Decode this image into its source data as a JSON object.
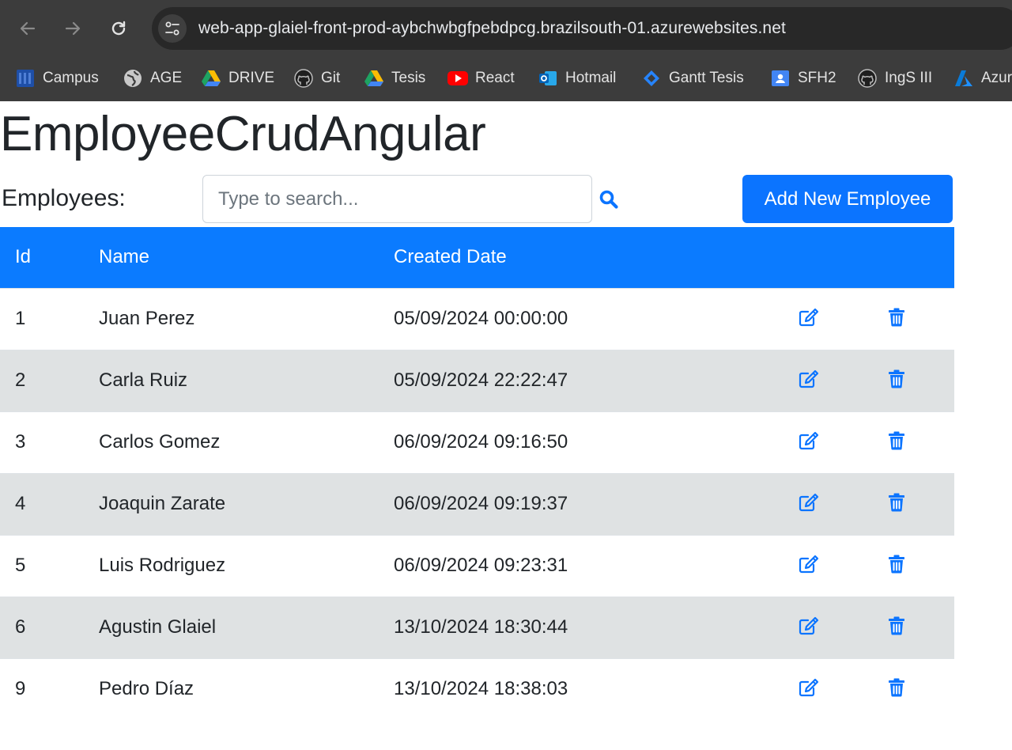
{
  "browser": {
    "url": "web-app-glaiel-front-prod-aybchwbgfpebdpcg.brazilsouth-01.azurewebsites.net",
    "bookmarks": [
      {
        "label": "Campus",
        "icon": "campus-icon"
      },
      {
        "label": "AGE",
        "icon": "globe-icon"
      },
      {
        "label": "DRIVE",
        "icon": "google-drive-icon"
      },
      {
        "label": "Git",
        "icon": "github-icon"
      },
      {
        "label": "Tesis",
        "icon": "google-drive-icon"
      },
      {
        "label": "React",
        "icon": "youtube-icon"
      },
      {
        "label": "Hotmail",
        "icon": "outlook-icon"
      },
      {
        "label": "Gantt Tesis",
        "icon": "jira-icon"
      },
      {
        "label": "SFH2",
        "icon": "contact-card-icon"
      },
      {
        "label": "IngS III",
        "icon": "github-icon"
      },
      {
        "label": "Azure",
        "icon": "azure-icon"
      }
    ]
  },
  "app": {
    "title": "EmployeeCrudAngular",
    "employees_label": "Employees:",
    "search_placeholder": "Type to search...",
    "add_button_label": "Add New Employee"
  },
  "table": {
    "columns": [
      "Id",
      "Name",
      "Created Date"
    ],
    "rows": [
      {
        "id": "1",
        "name": "Juan Perez",
        "created": "05/09/2024 00:00:00"
      },
      {
        "id": "2",
        "name": "Carla Ruiz",
        "created": "05/09/2024 22:22:47"
      },
      {
        "id": "3",
        "name": "Carlos Gomez",
        "created": "06/09/2024 09:16:50"
      },
      {
        "id": "4",
        "name": "Joaquin Zarate",
        "created": "06/09/2024 09:19:37"
      },
      {
        "id": "5",
        "name": "Luis Rodriguez",
        "created": "06/09/2024 09:23:31"
      },
      {
        "id": "6",
        "name": "Agustin Glaiel",
        "created": "13/10/2024 18:30:44"
      },
      {
        "id": "9",
        "name": "Pedro Díaz",
        "created": "13/10/2024 18:38:03"
      }
    ]
  },
  "colors": {
    "primary": "#0b7bff",
    "stripe": "#dfe2e3",
    "chrome": "#3c3c3c"
  }
}
